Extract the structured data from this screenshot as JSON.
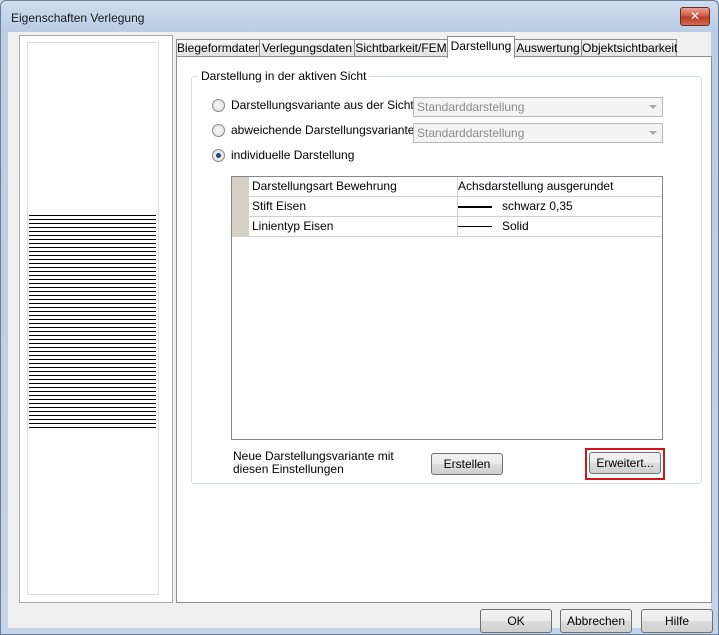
{
  "window": {
    "title": "Eigenschaften Verlegung",
    "close_label": "✕"
  },
  "tabs": [
    {
      "label": "Biegeformdaten",
      "active": false
    },
    {
      "label": "Verlegungsdaten",
      "active": false
    },
    {
      "label": "Sichtbarkeit/FEM",
      "active": false
    },
    {
      "label": "Darstellung",
      "active": true
    },
    {
      "label": "Auswertung",
      "active": false
    },
    {
      "label": "Objektsichtbarkeit",
      "active": false
    }
  ],
  "group": {
    "title": "Darstellung in der aktiven Sicht",
    "options": [
      {
        "label": "Darstellungsvariante aus der Sicht",
        "checked": false,
        "combo": "Standarddarstellung"
      },
      {
        "label": "abweichende Darstellungsvariante",
        "checked": false,
        "combo": "Standarddarstellung"
      },
      {
        "label": "individuelle Darstellung",
        "checked": true
      }
    ],
    "properties": [
      {
        "name": "Darstellungsart Bewehrung",
        "value": "Achsdarstellung ausgerundet"
      },
      {
        "name": "Stift Eisen",
        "value": "schwarz 0,35"
      },
      {
        "name": "Linientyp Eisen",
        "value": "Solid"
      }
    ],
    "new_variant_text": "Neue Darstellungsvariante mit diesen Einstellungen",
    "create_label": "Erstellen",
    "advanced_label": "Erweitert..."
  },
  "footer": {
    "ok_label": "OK",
    "cancel_label": "Abbrechen",
    "help_label": "Hilfe"
  },
  "colors": {
    "highlight": "#d4141b",
    "radio_dot": "#1f4a7c"
  }
}
